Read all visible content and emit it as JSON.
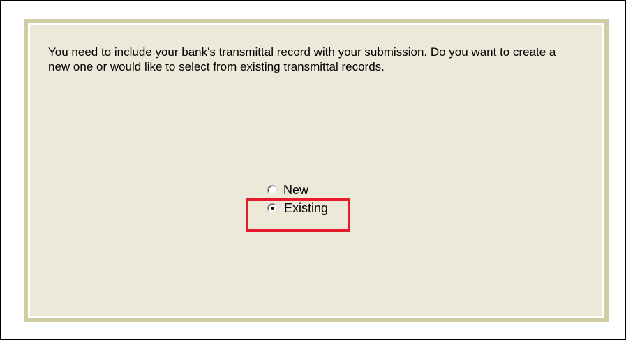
{
  "dialog": {
    "message": "You need to include your bank's transmittal record with your submission. Do you want to create a new one or would like to select from existing transmittal records.",
    "options": [
      {
        "label": "New",
        "selected": false
      },
      {
        "label": "Existing",
        "selected": true
      }
    ]
  },
  "colors": {
    "panel_background": "#ece9d8",
    "panel_border": "#cfcca2",
    "highlight": "#e8192c"
  }
}
